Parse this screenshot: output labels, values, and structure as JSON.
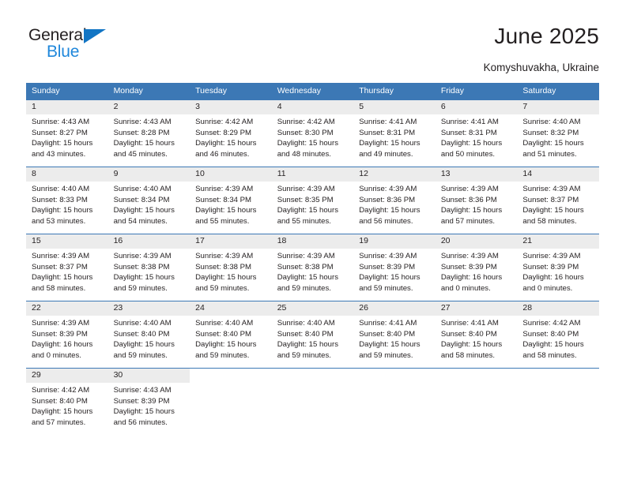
{
  "brand": {
    "logo_top": "General",
    "logo_bottom": "Blue",
    "logo_triangle_color": "#1275c4",
    "logo_bottom_color": "#1f87db"
  },
  "header": {
    "title": "June 2025",
    "subtitle": "Komyshuvakha, Ukraine"
  },
  "theme": {
    "header_bg": "#3c78b5",
    "daynum_bg": "#ececec",
    "text": "#231f20"
  },
  "calendar": {
    "weekday_headers": [
      "Sunday",
      "Monday",
      "Tuesday",
      "Wednesday",
      "Thursday",
      "Friday",
      "Saturday"
    ],
    "weeks": [
      [
        {
          "day": "1",
          "sunrise": "Sunrise: 4:43 AM",
          "sunset": "Sunset: 8:27 PM",
          "daylight_line1": "Daylight: 15 hours",
          "daylight_line2": "and 43 minutes."
        },
        {
          "day": "2",
          "sunrise": "Sunrise: 4:43 AM",
          "sunset": "Sunset: 8:28 PM",
          "daylight_line1": "Daylight: 15 hours",
          "daylight_line2": "and 45 minutes."
        },
        {
          "day": "3",
          "sunrise": "Sunrise: 4:42 AM",
          "sunset": "Sunset: 8:29 PM",
          "daylight_line1": "Daylight: 15 hours",
          "daylight_line2": "and 46 minutes."
        },
        {
          "day": "4",
          "sunrise": "Sunrise: 4:42 AM",
          "sunset": "Sunset: 8:30 PM",
          "daylight_line1": "Daylight: 15 hours",
          "daylight_line2": "and 48 minutes."
        },
        {
          "day": "5",
          "sunrise": "Sunrise: 4:41 AM",
          "sunset": "Sunset: 8:31 PM",
          "daylight_line1": "Daylight: 15 hours",
          "daylight_line2": "and 49 minutes."
        },
        {
          "day": "6",
          "sunrise": "Sunrise: 4:41 AM",
          "sunset": "Sunset: 8:31 PM",
          "daylight_line1": "Daylight: 15 hours",
          "daylight_line2": "and 50 minutes."
        },
        {
          "day": "7",
          "sunrise": "Sunrise: 4:40 AM",
          "sunset": "Sunset: 8:32 PM",
          "daylight_line1": "Daylight: 15 hours",
          "daylight_line2": "and 51 minutes."
        }
      ],
      [
        {
          "day": "8",
          "sunrise": "Sunrise: 4:40 AM",
          "sunset": "Sunset: 8:33 PM",
          "daylight_line1": "Daylight: 15 hours",
          "daylight_line2": "and 53 minutes."
        },
        {
          "day": "9",
          "sunrise": "Sunrise: 4:40 AM",
          "sunset": "Sunset: 8:34 PM",
          "daylight_line1": "Daylight: 15 hours",
          "daylight_line2": "and 54 minutes."
        },
        {
          "day": "10",
          "sunrise": "Sunrise: 4:39 AM",
          "sunset": "Sunset: 8:34 PM",
          "daylight_line1": "Daylight: 15 hours",
          "daylight_line2": "and 55 minutes."
        },
        {
          "day": "11",
          "sunrise": "Sunrise: 4:39 AM",
          "sunset": "Sunset: 8:35 PM",
          "daylight_line1": "Daylight: 15 hours",
          "daylight_line2": "and 55 minutes."
        },
        {
          "day": "12",
          "sunrise": "Sunrise: 4:39 AM",
          "sunset": "Sunset: 8:36 PM",
          "daylight_line1": "Daylight: 15 hours",
          "daylight_line2": "and 56 minutes."
        },
        {
          "day": "13",
          "sunrise": "Sunrise: 4:39 AM",
          "sunset": "Sunset: 8:36 PM",
          "daylight_line1": "Daylight: 15 hours",
          "daylight_line2": "and 57 minutes."
        },
        {
          "day": "14",
          "sunrise": "Sunrise: 4:39 AM",
          "sunset": "Sunset: 8:37 PM",
          "daylight_line1": "Daylight: 15 hours",
          "daylight_line2": "and 58 minutes."
        }
      ],
      [
        {
          "day": "15",
          "sunrise": "Sunrise: 4:39 AM",
          "sunset": "Sunset: 8:37 PM",
          "daylight_line1": "Daylight: 15 hours",
          "daylight_line2": "and 58 minutes."
        },
        {
          "day": "16",
          "sunrise": "Sunrise: 4:39 AM",
          "sunset": "Sunset: 8:38 PM",
          "daylight_line1": "Daylight: 15 hours",
          "daylight_line2": "and 59 minutes."
        },
        {
          "day": "17",
          "sunrise": "Sunrise: 4:39 AM",
          "sunset": "Sunset: 8:38 PM",
          "daylight_line1": "Daylight: 15 hours",
          "daylight_line2": "and 59 minutes."
        },
        {
          "day": "18",
          "sunrise": "Sunrise: 4:39 AM",
          "sunset": "Sunset: 8:38 PM",
          "daylight_line1": "Daylight: 15 hours",
          "daylight_line2": "and 59 minutes."
        },
        {
          "day": "19",
          "sunrise": "Sunrise: 4:39 AM",
          "sunset": "Sunset: 8:39 PM",
          "daylight_line1": "Daylight: 15 hours",
          "daylight_line2": "and 59 minutes."
        },
        {
          "day": "20",
          "sunrise": "Sunrise: 4:39 AM",
          "sunset": "Sunset: 8:39 PM",
          "daylight_line1": "Daylight: 16 hours",
          "daylight_line2": "and 0 minutes."
        },
        {
          "day": "21",
          "sunrise": "Sunrise: 4:39 AM",
          "sunset": "Sunset: 8:39 PM",
          "daylight_line1": "Daylight: 16 hours",
          "daylight_line2": "and 0 minutes."
        }
      ],
      [
        {
          "day": "22",
          "sunrise": "Sunrise: 4:39 AM",
          "sunset": "Sunset: 8:39 PM",
          "daylight_line1": "Daylight: 16 hours",
          "daylight_line2": "and 0 minutes."
        },
        {
          "day": "23",
          "sunrise": "Sunrise: 4:40 AM",
          "sunset": "Sunset: 8:40 PM",
          "daylight_line1": "Daylight: 15 hours",
          "daylight_line2": "and 59 minutes."
        },
        {
          "day": "24",
          "sunrise": "Sunrise: 4:40 AM",
          "sunset": "Sunset: 8:40 PM",
          "daylight_line1": "Daylight: 15 hours",
          "daylight_line2": "and 59 minutes."
        },
        {
          "day": "25",
          "sunrise": "Sunrise: 4:40 AM",
          "sunset": "Sunset: 8:40 PM",
          "daylight_line1": "Daylight: 15 hours",
          "daylight_line2": "and 59 minutes."
        },
        {
          "day": "26",
          "sunrise": "Sunrise: 4:41 AM",
          "sunset": "Sunset: 8:40 PM",
          "daylight_line1": "Daylight: 15 hours",
          "daylight_line2": "and 59 minutes."
        },
        {
          "day": "27",
          "sunrise": "Sunrise: 4:41 AM",
          "sunset": "Sunset: 8:40 PM",
          "daylight_line1": "Daylight: 15 hours",
          "daylight_line2": "and 58 minutes."
        },
        {
          "day": "28",
          "sunrise": "Sunrise: 4:42 AM",
          "sunset": "Sunset: 8:40 PM",
          "daylight_line1": "Daylight: 15 hours",
          "daylight_line2": "and 58 minutes."
        }
      ],
      [
        {
          "day": "29",
          "sunrise": "Sunrise: 4:42 AM",
          "sunset": "Sunset: 8:40 PM",
          "daylight_line1": "Daylight: 15 hours",
          "daylight_line2": "and 57 minutes."
        },
        {
          "day": "30",
          "sunrise": "Sunrise: 4:43 AM",
          "sunset": "Sunset: 8:39 PM",
          "daylight_line1": "Daylight: 15 hours",
          "daylight_line2": "and 56 minutes."
        },
        {
          "day": "",
          "sunrise": "",
          "sunset": "",
          "daylight_line1": "",
          "daylight_line2": ""
        },
        {
          "day": "",
          "sunrise": "",
          "sunset": "",
          "daylight_line1": "",
          "daylight_line2": ""
        },
        {
          "day": "",
          "sunrise": "",
          "sunset": "",
          "daylight_line1": "",
          "daylight_line2": ""
        },
        {
          "day": "",
          "sunrise": "",
          "sunset": "",
          "daylight_line1": "",
          "daylight_line2": ""
        },
        {
          "day": "",
          "sunrise": "",
          "sunset": "",
          "daylight_line1": "",
          "daylight_line2": ""
        }
      ]
    ]
  }
}
